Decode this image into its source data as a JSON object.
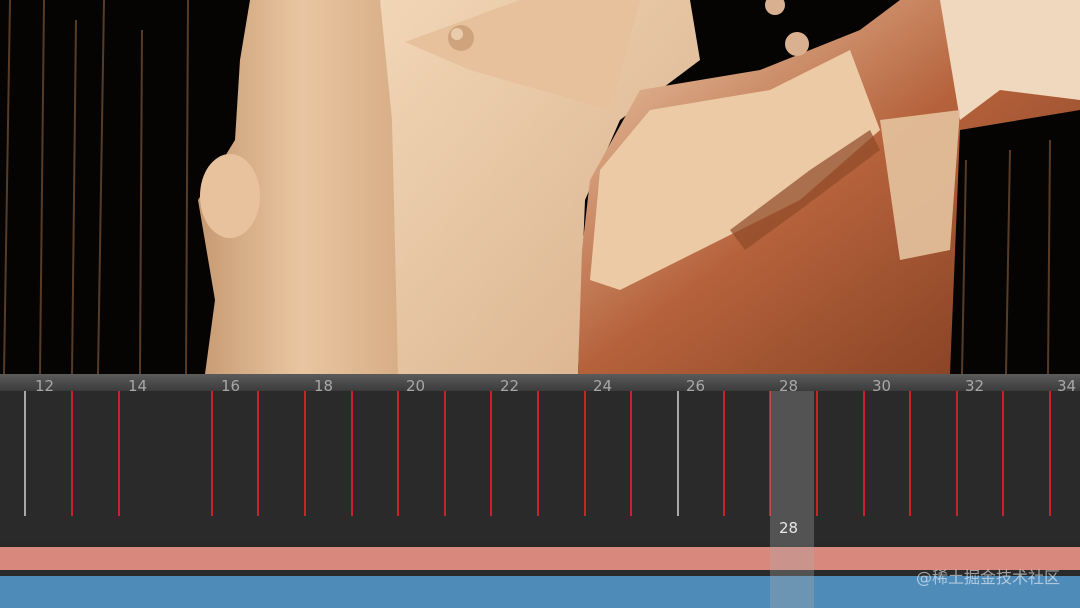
{
  "timeline": {
    "frames": [
      "12",
      "14",
      "16",
      "18",
      "20",
      "22",
      "24",
      "26",
      "28",
      "30",
      "32",
      "34"
    ],
    "current_frame": "28"
  },
  "watermark": "@稀土掘金技术社区"
}
